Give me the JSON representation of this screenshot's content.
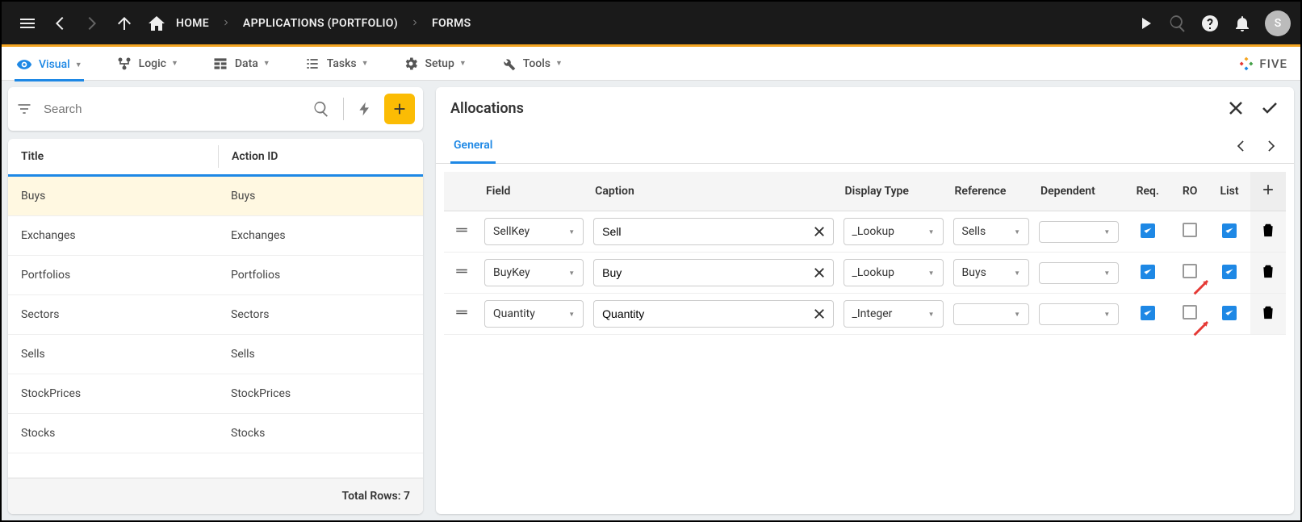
{
  "topbar": {
    "home_label": "HOME",
    "crumb1": "APPLICATIONS (PORTFOLIO)",
    "crumb2": "FORMS",
    "avatar_initial": "S"
  },
  "menubar": {
    "visual": "Visual",
    "logic": "Logic",
    "data": "Data",
    "tasks": "Tasks",
    "setup": "Setup",
    "tools": "Tools",
    "brand": "FIVE"
  },
  "left": {
    "search_placeholder": "Search",
    "col_title": "Title",
    "col_action": "Action ID",
    "rows": [
      {
        "title": "Buys",
        "action": "Buys",
        "selected": true
      },
      {
        "title": "Exchanges",
        "action": "Exchanges"
      },
      {
        "title": "Portfolios",
        "action": "Portfolios"
      },
      {
        "title": "Sectors",
        "action": "Sectors"
      },
      {
        "title": "Sells",
        "action": "Sells"
      },
      {
        "title": "StockPrices",
        "action": "StockPrices"
      },
      {
        "title": "Stocks",
        "action": "Stocks"
      }
    ],
    "footer": "Total Rows: 7"
  },
  "right": {
    "title": "Allocations",
    "tab_general": "General",
    "cols": {
      "field": "Field",
      "caption": "Caption",
      "display_type": "Display Type",
      "reference": "Reference",
      "dependent": "Dependent",
      "req": "Req.",
      "ro": "RO",
      "list": "List"
    },
    "rows": [
      {
        "field": "SellKey",
        "caption": "Sell",
        "display": "_Lookup",
        "reference": "Sells",
        "dependent": "",
        "req": true,
        "ro": false,
        "list": true
      },
      {
        "field": "BuyKey",
        "caption": "Buy",
        "display": "_Lookup",
        "reference": "Buys",
        "dependent": "",
        "req": true,
        "ro": false,
        "list": true,
        "arrow": true
      },
      {
        "field": "Quantity",
        "caption": "Quantity",
        "display": "_Integer",
        "reference": "",
        "dependent": "",
        "req": true,
        "ro": false,
        "list": true,
        "arrow": true
      }
    ]
  }
}
